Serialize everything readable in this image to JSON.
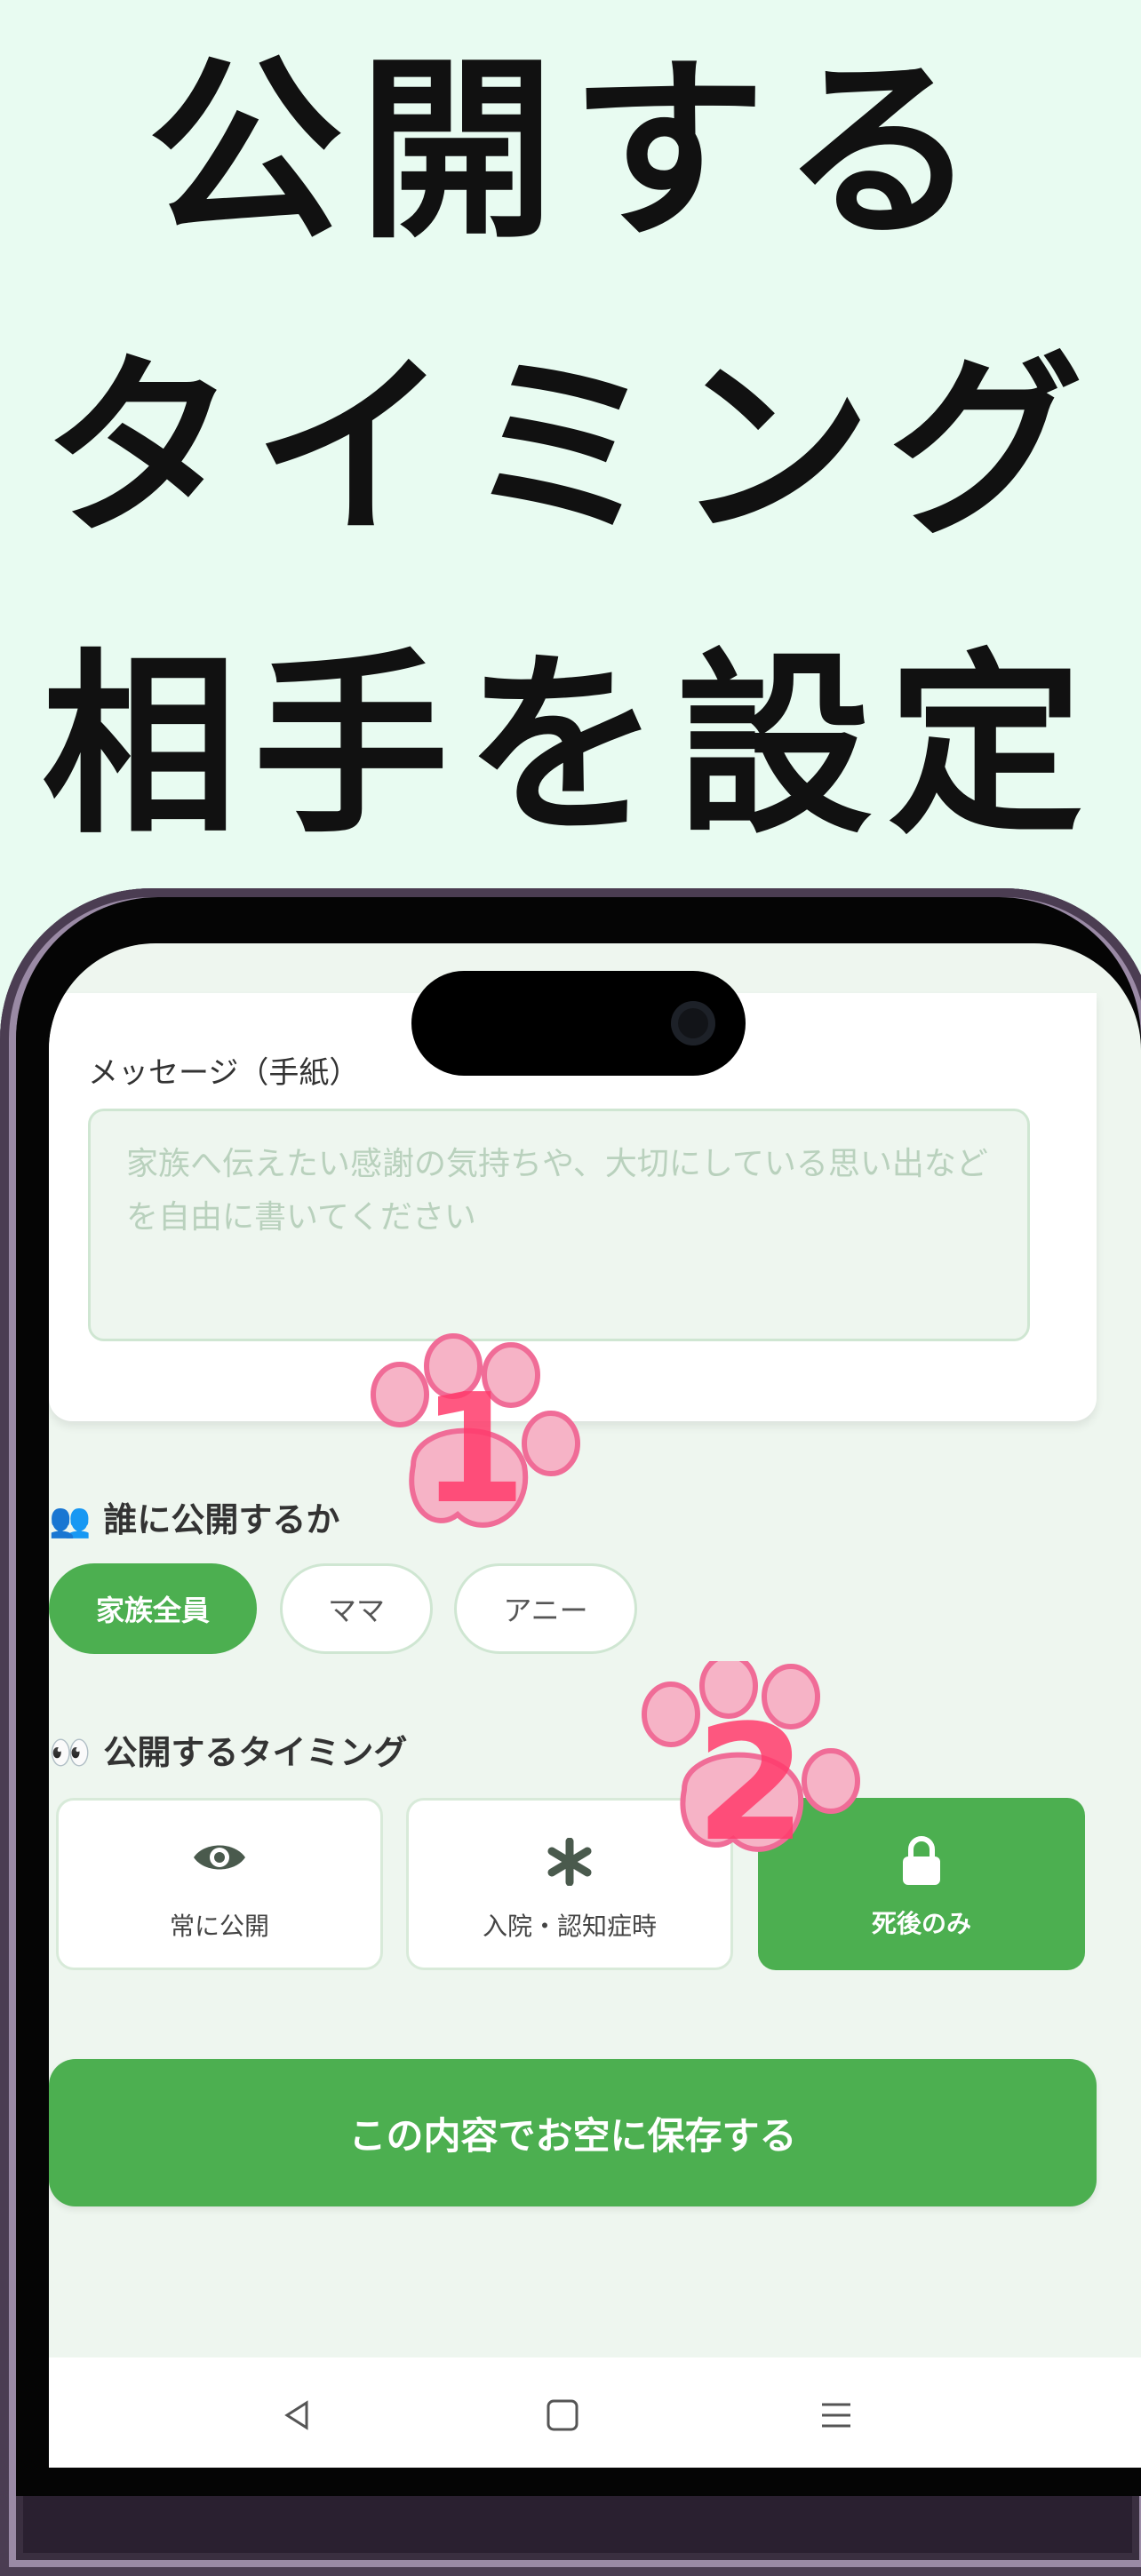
{
  "headline": {
    "line1": "公開する",
    "line2": "タイミング",
    "line3": "相手を設定"
  },
  "message_card": {
    "label": "メッセージ（手紙）",
    "placeholder": "家族へ伝えたい感謝の気持ちや、大切にしている思い出などを自由に書いてください"
  },
  "audience": {
    "emoji": "👥",
    "title": "誰に公開するか",
    "options": [
      {
        "label": "家族全員",
        "selected": true
      },
      {
        "label": "ママ",
        "selected": false
      },
      {
        "label": "アニー",
        "selected": false
      }
    ]
  },
  "timing": {
    "emoji": "👀",
    "title": "公開するタイミング",
    "options": [
      {
        "label": "常に公開",
        "icon": "eye-icon",
        "selected": false
      },
      {
        "label": "入院・認知症時",
        "icon": "asterisk-icon",
        "selected": false
      },
      {
        "label": "死後のみ",
        "icon": "lock-icon",
        "selected": true
      }
    ]
  },
  "save_button": "この内容でお空に保存する",
  "annotations": {
    "step1": "1",
    "step2": "2"
  },
  "colors": {
    "background": "#e8fbf1",
    "accent_green": "#4caf50",
    "paw_pink": "#f6a9c0",
    "number_red": "#ff3b6b"
  }
}
